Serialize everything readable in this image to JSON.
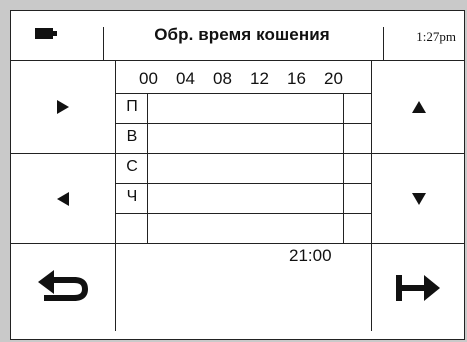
{
  "header": {
    "battery_icon": "battery-icon",
    "title": "Обр. время кошения",
    "time": "1:27pm"
  },
  "buttons": {
    "left_top": "play-right-icon",
    "left_mid": "arrow-left-icon",
    "left_bottom": "back-icon",
    "right_top": "arrow-up-icon",
    "right_mid": "arrow-down-icon",
    "right_bottom": "forward-icon"
  },
  "schedule": {
    "hours": [
      "00",
      "04",
      "08",
      "12",
      "16",
      "20"
    ],
    "days": [
      "П",
      "В",
      "С",
      "Ч",
      ""
    ],
    "current_time": "21:00"
  }
}
